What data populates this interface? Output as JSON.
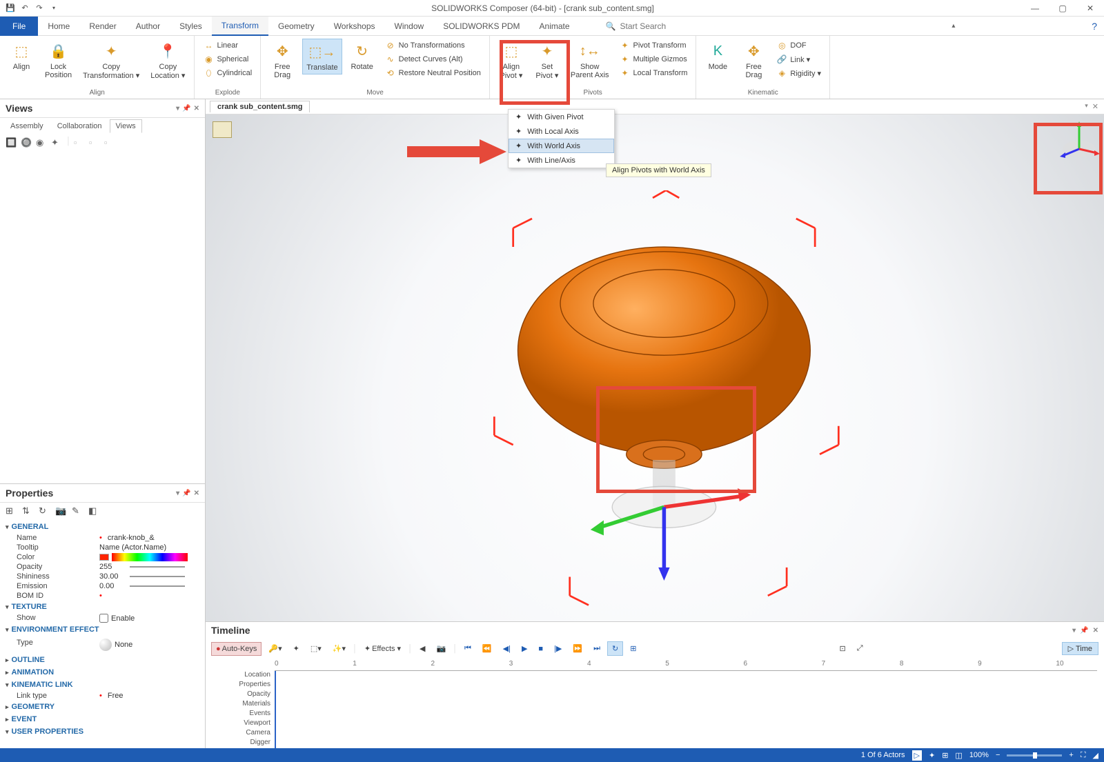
{
  "titlebar": {
    "title": "SOLIDWORKS Composer (64-bit) - [crank sub_content.smg]"
  },
  "tabs": {
    "file": "File",
    "home": "Home",
    "render": "Render",
    "author": "Author",
    "styles": "Styles",
    "transform": "Transform",
    "geometry": "Geometry",
    "workshops": "Workshops",
    "window": "Window",
    "pdm": "SOLIDWORKS PDM",
    "animate": "Animate"
  },
  "search": {
    "placeholder": "Start Search"
  },
  "ribbon": {
    "align": {
      "label": "Align",
      "align": "Align",
      "lockpos": "Lock\nPosition",
      "copytrans": "Copy\nTransformation ▾",
      "copyloc": "Copy\nLocation ▾"
    },
    "explode": {
      "label": "Explode",
      "linear": "Linear",
      "spherical": "Spherical",
      "cylindrical": "Cylindrical"
    },
    "move": {
      "label": "Move",
      "free": "Free\nDrag",
      "translate": "Translate",
      "rotate": "Rotate",
      "notrans": "No Transformations",
      "detect": "Detect Curves (Alt)",
      "restore": "Restore Neutral Position"
    },
    "pivot": {
      "label": "Pivots",
      "alignpivot": "Align\nPivot ▾",
      "setpivot": "Set\nPivot ▾",
      "showparent": "Show\nParent Axis",
      "pivottrans": "Pivot Transform",
      "multgizmo": "Multiple Gizmos",
      "localtrans": "Local Transform"
    },
    "kinematic": {
      "label": "Kinematic",
      "mode": "Mode",
      "freedrag": "Free\nDrag",
      "dof": "DOF",
      "link": "Link ▾",
      "rigidity": "Rigidity ▾"
    }
  },
  "dropdown": {
    "given": "With Given Pivot",
    "local": "With Local Axis",
    "world": "With World Axis",
    "line": "With Line/Axis",
    "tooltip": "Align Pivots with World Axis"
  },
  "views": {
    "title": "Views",
    "tabs": {
      "assembly": "Assembly",
      "collab": "Collaboration",
      "views": "Views"
    }
  },
  "doctab": "crank sub_content.smg",
  "properties": {
    "title": "Properties",
    "cats": {
      "general": "GENERAL",
      "texture": "TEXTURE",
      "envfx": "ENVIRONMENT EFFECT",
      "outline": "OUTLINE",
      "animation": "ANIMATION",
      "kinlink": "KINEMATIC LINK",
      "geometry": "GEOMETRY",
      "event": "EVENT",
      "userprops": "USER PROPERTIES"
    },
    "rows": {
      "name": {
        "l": "Name",
        "v": "crank-knob_&"
      },
      "tooltip": {
        "l": "Tooltip",
        "v": "Name (Actor.Name)"
      },
      "color": {
        "l": "Color"
      },
      "opacity": {
        "l": "Opacity",
        "v": "255"
      },
      "shininess": {
        "l": "Shininess",
        "v": "30.00"
      },
      "emission": {
        "l": "Emission",
        "v": "0.00"
      },
      "bomid": {
        "l": "BOM ID"
      },
      "show": {
        "l": "Show",
        "v": "Enable"
      },
      "type": {
        "l": "Type",
        "v": "None"
      },
      "linktype": {
        "l": "Link type",
        "v": "Free"
      }
    }
  },
  "timeline": {
    "title": "Timeline",
    "auto": "Auto-Keys",
    "effects": "Effects ▾",
    "time": "Time",
    "ticks": [
      "0",
      "1",
      "2",
      "3",
      "4",
      "5",
      "6",
      "7",
      "8",
      "9",
      "10"
    ],
    "tracks": [
      "Location",
      "Properties",
      "Opacity",
      "Materials",
      "Events",
      "Viewport",
      "Camera",
      "Digger"
    ]
  },
  "status": {
    "actors": "1 Of 6 Actors",
    "zoom": "100%"
  }
}
